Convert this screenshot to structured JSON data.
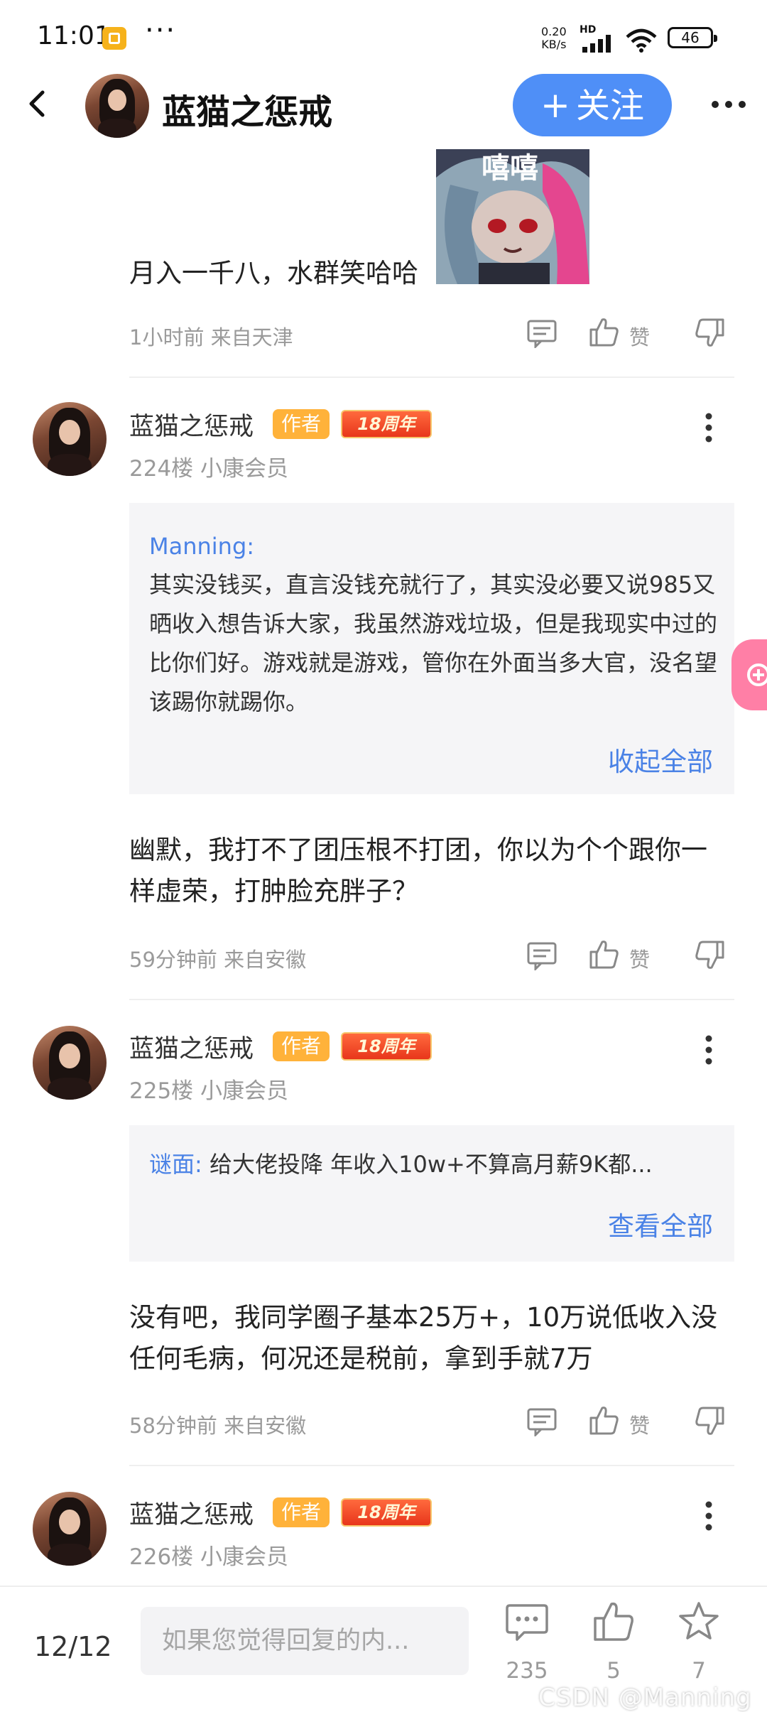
{
  "status_bar": {
    "time": "11:01",
    "dots": "···",
    "speed_line1": "0.20",
    "speed_line2": "KB/s",
    "hd": "HD",
    "battery": "46"
  },
  "header": {
    "title": "蓝猫之惩戒",
    "follow_label": "关注",
    "follow_plus": "+"
  },
  "post_top": {
    "text": "月入一千八，水群笑哈哈",
    "meta": "1小时前 来自天津",
    "like_label": "赞",
    "sticker_text": "嘻嘻"
  },
  "floors": [
    {
      "username": "蓝猫之惩戒",
      "author_badge": "作者",
      "anniversary_badge": "18周年",
      "floor_info": "224楼 小康会员",
      "quote": {
        "name": "Manning:",
        "text": "其实没钱买，直言没钱充就行了，其实没必要又说985又晒收入想告诉大家，我虽然游戏垃圾，但是我现实中过的比你们好。游戏就是游戏，管你在外面当多大官，没名望该踢你就踢你。",
        "link": "收起全部"
      },
      "text": "幽默，我打不了团压根不打团，你以为个个跟你一样虚荣，打肿脸充胖子？",
      "meta": "59分钟前 来自安徽",
      "like_label": "赞"
    },
    {
      "username": "蓝猫之惩戒",
      "author_badge": "作者",
      "anniversary_badge": "18周年",
      "floor_info": "225楼 小康会员",
      "quote": {
        "name": "谜面:",
        "text": "给大佬投降 年收入10w+不算高月薪9K都...",
        "link": "查看全部"
      },
      "text": "没有吧，我同学圈子基本25万+，10万说低收入没任何毛病，何况还是税前，拿到手就7万",
      "meta": "58分钟前 来自安徽",
      "like_label": "赞"
    },
    {
      "username": "蓝猫之惩戒",
      "author_badge": "作者",
      "anniversary_badge": "18周年",
      "floor_info": "226楼 小康会员"
    }
  ],
  "bottom_bar": {
    "page_indicator": "12/12",
    "reply_placeholder": "如果您觉得回复的内...",
    "comment_count": "235",
    "like_count": "5",
    "star_count": "7",
    "watermark": "CSDN @Manning"
  },
  "colors": {
    "accent": "#4f8ff7",
    "link": "#4a82e6",
    "author_badge": "#ffb23a",
    "meta_gray": "#9a9a9a"
  }
}
